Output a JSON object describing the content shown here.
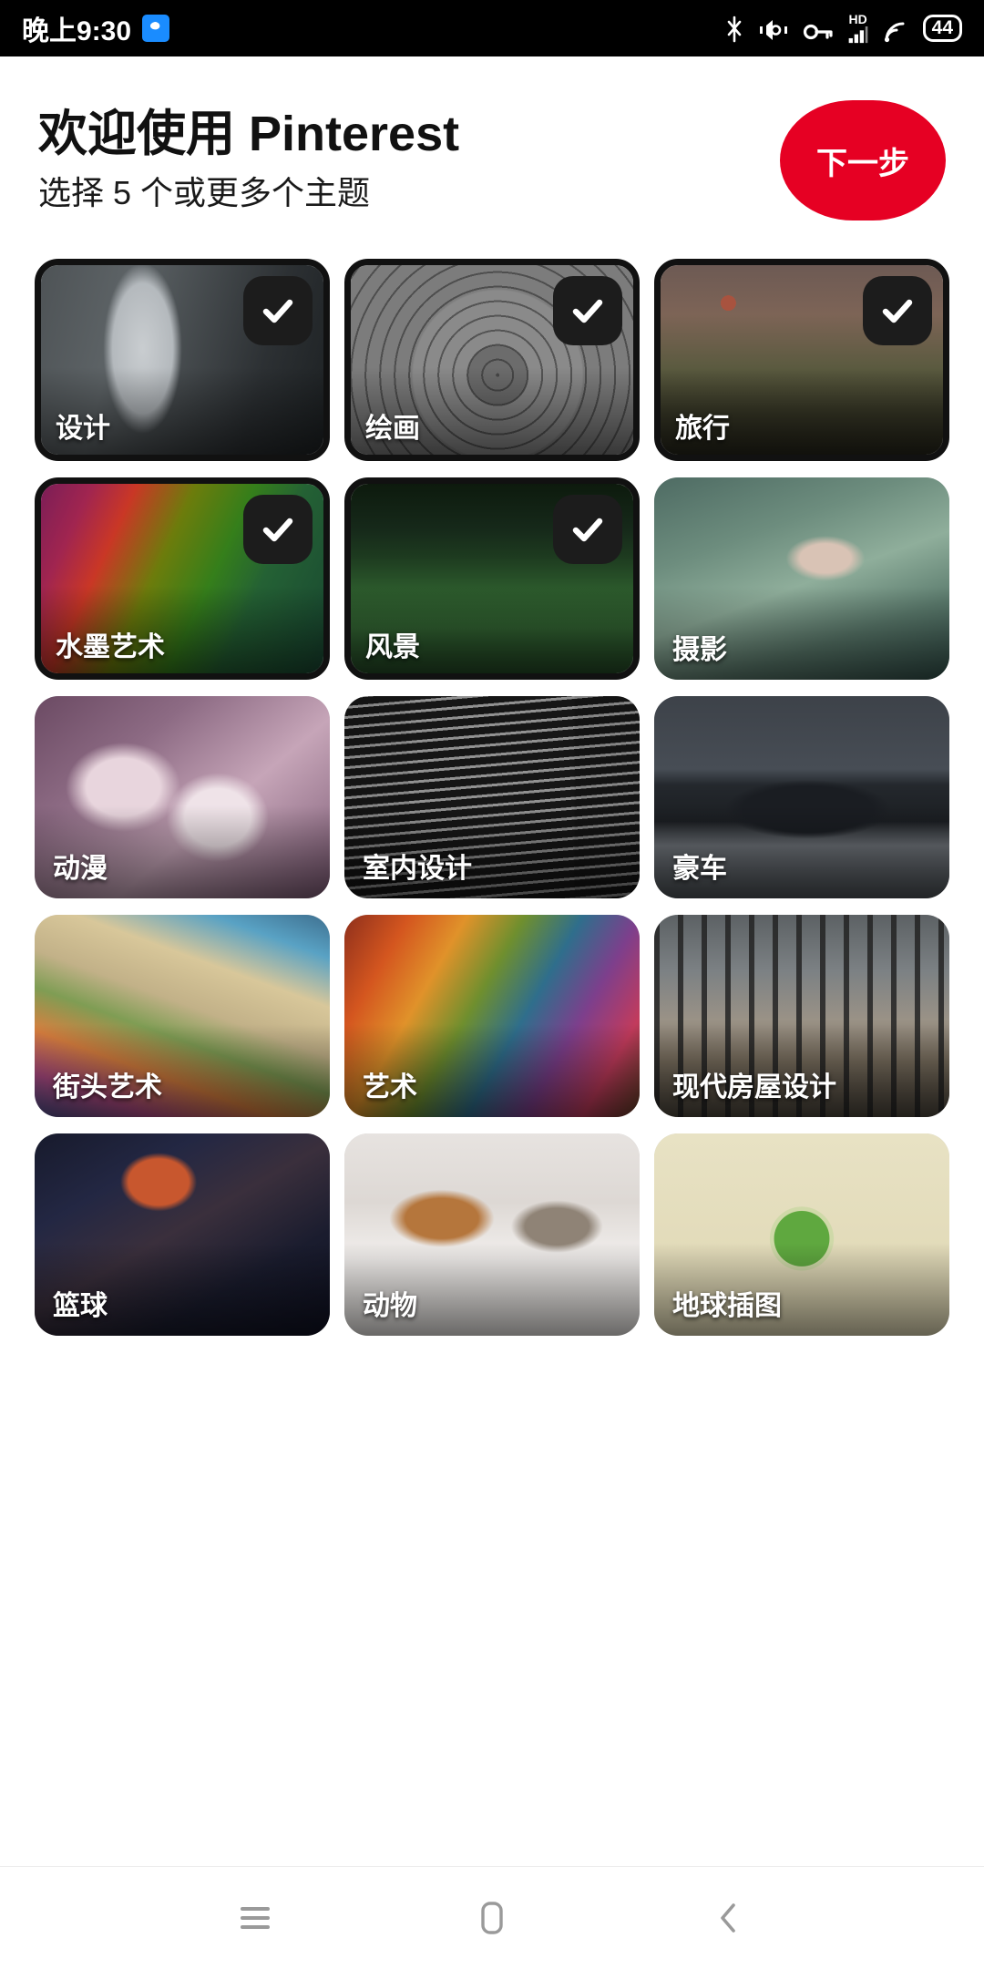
{
  "statusbar": {
    "time": "晚上9:30",
    "app_icon": "weibo-app-icon",
    "icons": [
      "bluetooth-off-icon",
      "volume-icon",
      "vpn-key-icon",
      "hd-icon",
      "signal-icon",
      "wifi-icon"
    ],
    "hd_label": "HD",
    "battery_level": "44"
  },
  "header": {
    "title": "欢迎使用 Pinterest",
    "subtitle": "选择 5 个或更多个主题",
    "next_label": "下一步",
    "accent_color": "#e60023"
  },
  "grid": {
    "tiles": [
      {
        "label": "设计",
        "art": "art-design",
        "selected": true
      },
      {
        "label": "绘画",
        "art": "art-painting",
        "selected": true
      },
      {
        "label": "旅行",
        "art": "art-travel",
        "selected": true
      },
      {
        "label": "水墨艺术",
        "art": "art-ink",
        "selected": true
      },
      {
        "label": "风景",
        "art": "art-landscape",
        "selected": true
      },
      {
        "label": "摄影",
        "art": "art-photo",
        "selected": false
      },
      {
        "label": "动漫",
        "art": "art-anime",
        "selected": false
      },
      {
        "label": "室内设计",
        "art": "art-interior",
        "selected": false
      },
      {
        "label": "豪车",
        "art": "art-car",
        "selected": false
      },
      {
        "label": "街头艺术",
        "art": "art-street",
        "selected": false
      },
      {
        "label": "艺术",
        "art": "art-art",
        "selected": false
      },
      {
        "label": "现代房屋设计",
        "art": "art-modern",
        "selected": false
      },
      {
        "label": "篮球",
        "art": "art-basketball",
        "selected": false
      },
      {
        "label": "动物",
        "art": "art-animal",
        "selected": false
      },
      {
        "label": "地球插图",
        "art": "art-earth",
        "selected": false
      }
    ]
  },
  "navbar": {
    "items": [
      {
        "name": "recents-nav-button",
        "icon": "menu-icon"
      },
      {
        "name": "home-nav-button",
        "icon": "home-square-icon"
      },
      {
        "name": "back-nav-button",
        "icon": "chevron-left-icon"
      }
    ]
  }
}
